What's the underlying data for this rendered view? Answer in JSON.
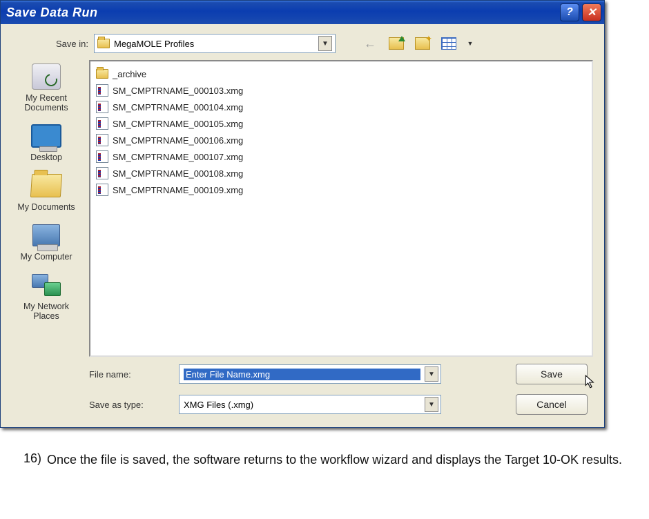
{
  "titlebar": {
    "title": "Save Data Run"
  },
  "savein": {
    "label": "Save in:",
    "value": "MegaMOLE Profiles"
  },
  "sidebar": {
    "places": [
      {
        "label": "My Recent Documents",
        "iconClass": "icon-recent"
      },
      {
        "label": "Desktop",
        "iconClass": "icon-desktop"
      },
      {
        "label": "My Documents",
        "iconClass": "icon-mydocs"
      },
      {
        "label": "My Computer",
        "iconClass": "icon-mycomp"
      },
      {
        "label": "My Network Places",
        "iconClass": "icon-network"
      }
    ]
  },
  "files": {
    "folder": "_archive",
    "items": [
      "SM_CMPTRNAME_000103.xmg",
      "SM_CMPTRNAME_000104.xmg",
      "SM_CMPTRNAME_000105.xmg",
      "SM_CMPTRNAME_000106.xmg",
      "SM_CMPTRNAME_000107.xmg",
      "SM_CMPTRNAME_000108.xmg",
      "SM_CMPTRNAME_000109.xmg"
    ]
  },
  "filename": {
    "label": "File name:",
    "value": "Enter File Name.xmg"
  },
  "filetype": {
    "label": "Save as type:",
    "value": "XMG Files (.xmg)"
  },
  "buttons": {
    "save": "Save",
    "cancel": "Cancel"
  },
  "caption": {
    "number": "16)",
    "text": "Once the file is saved, the software returns to the workflow wizard and displays the Target 10-OK results."
  }
}
